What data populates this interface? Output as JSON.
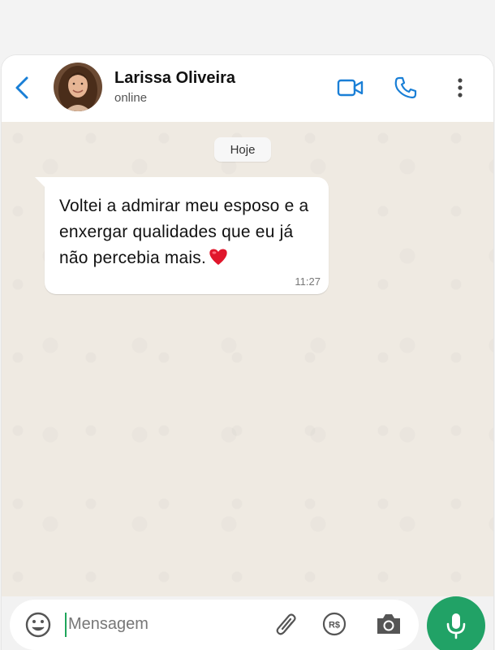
{
  "contact": {
    "name": "Larissa Oliveira",
    "status": "online"
  },
  "header_icons": [
    "back-arrow-icon",
    "video-call-icon",
    "phone-call-icon",
    "more-options-icon"
  ],
  "chat": {
    "date_label": "Hoje",
    "messages": [
      {
        "text": "Voltei a admirar meu esposo e a enxergar qualidades que eu já não percebia mais.",
        "emoji": "❤️",
        "time": "11:27"
      }
    ]
  },
  "composer": {
    "placeholder": "Mensagem",
    "icons": [
      "emoji-icon",
      "attachment-icon",
      "payment-icon",
      "camera-icon",
      "microphone-icon"
    ]
  },
  "colors": {
    "accent": "#1a7fd6",
    "send_button": "#21a266",
    "chat_background": "#efeae2",
    "bubble": "#ffffff"
  }
}
